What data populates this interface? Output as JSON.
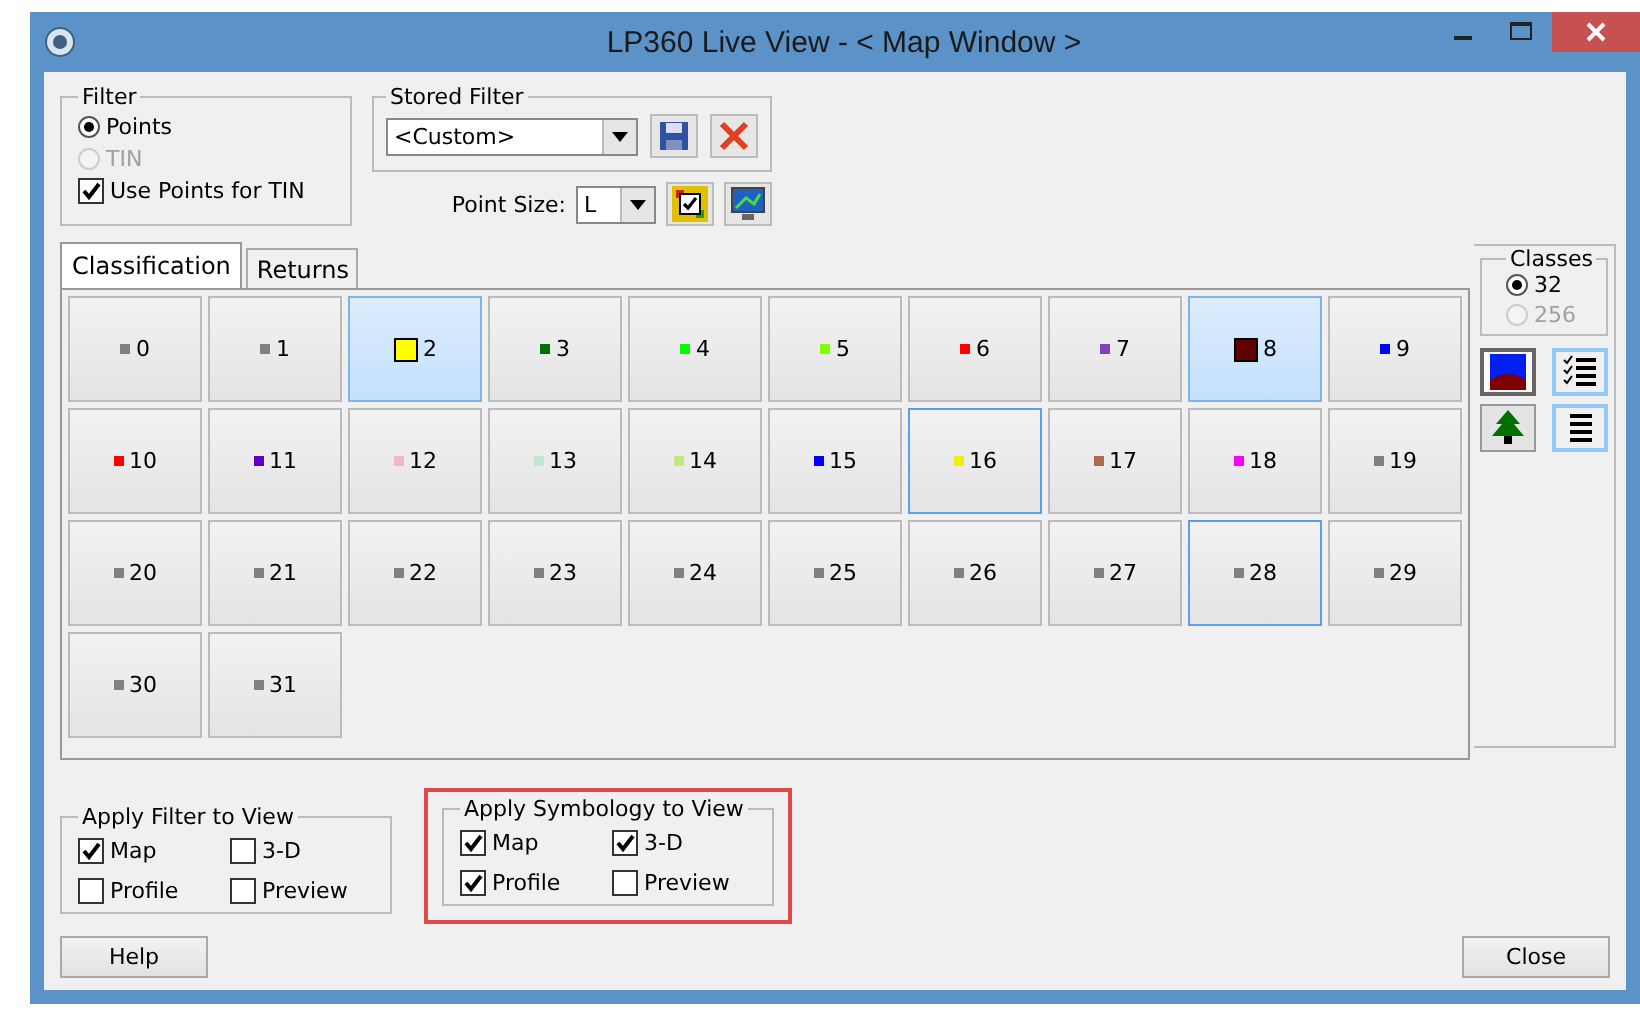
{
  "window": {
    "title": "LP360 Live View - < Map Window >"
  },
  "filter": {
    "title": "Filter",
    "options": [
      {
        "label": "Points",
        "selected": true,
        "disabled": false
      },
      {
        "label": "TIN",
        "selected": false,
        "disabled": true
      }
    ],
    "use_points_for_tin": {
      "label": "Use Points for TIN",
      "checked": true
    }
  },
  "stored_filter": {
    "title": "Stored Filter",
    "value": "<Custom>"
  },
  "point_size": {
    "label": "Point Size:",
    "value": "L"
  },
  "tabs": [
    {
      "label": "Classification",
      "selected": true
    },
    {
      "label": "Returns",
      "selected": false
    }
  ],
  "classes": [
    {
      "label": "0",
      "color": "#808080",
      "selected": false,
      "outlined": false
    },
    {
      "label": "1",
      "color": "#808080",
      "selected": false,
      "outlined": false
    },
    {
      "label": "2",
      "color": "#ffff00",
      "selected": true,
      "outlined": false
    },
    {
      "label": "3",
      "color": "#007000",
      "selected": false,
      "outlined": false
    },
    {
      "label": "4",
      "color": "#00ff00",
      "selected": false,
      "outlined": false
    },
    {
      "label": "5",
      "color": "#80ff00",
      "selected": false,
      "outlined": false
    },
    {
      "label": "6",
      "color": "#ff0000",
      "selected": false,
      "outlined": false
    },
    {
      "label": "7",
      "color": "#8040c0",
      "selected": false,
      "outlined": false
    },
    {
      "label": "8",
      "color": "#600000",
      "selected": true,
      "outlined": false
    },
    {
      "label": "9",
      "color": "#0000ff",
      "selected": false,
      "outlined": false
    },
    {
      "label": "10",
      "color": "#ff0000",
      "selected": false,
      "outlined": false
    },
    {
      "label": "11",
      "color": "#6000c0",
      "selected": false,
      "outlined": false
    },
    {
      "label": "12",
      "color": "#f0b8c8",
      "selected": false,
      "outlined": false
    },
    {
      "label": "13",
      "color": "#c0e8d0",
      "selected": false,
      "outlined": false
    },
    {
      "label": "14",
      "color": "#c0e880",
      "selected": false,
      "outlined": false
    },
    {
      "label": "15",
      "color": "#0000ff",
      "selected": false,
      "outlined": false
    },
    {
      "label": "16",
      "color": "#f0f000",
      "selected": false,
      "outlined": true
    },
    {
      "label": "17",
      "color": "#b06850",
      "selected": false,
      "outlined": false
    },
    {
      "label": "18",
      "color": "#ff00ff",
      "selected": false,
      "outlined": false
    },
    {
      "label": "19",
      "color": "#808080",
      "selected": false,
      "outlined": false
    },
    {
      "label": "20",
      "color": "#808080",
      "selected": false,
      "outlined": false
    },
    {
      "label": "21",
      "color": "#808080",
      "selected": false,
      "outlined": false
    },
    {
      "label": "22",
      "color": "#808080",
      "selected": false,
      "outlined": false
    },
    {
      "label": "23",
      "color": "#808080",
      "selected": false,
      "outlined": false
    },
    {
      "label": "24",
      "color": "#808080",
      "selected": false,
      "outlined": false
    },
    {
      "label": "25",
      "color": "#808080",
      "selected": false,
      "outlined": false
    },
    {
      "label": "26",
      "color": "#808080",
      "selected": false,
      "outlined": false
    },
    {
      "label": "27",
      "color": "#808080",
      "selected": false,
      "outlined": false
    },
    {
      "label": "28",
      "color": "#808080",
      "selected": false,
      "outlined": true
    },
    {
      "label": "29",
      "color": "#808080",
      "selected": false,
      "outlined": false
    },
    {
      "label": "30",
      "color": "#808080",
      "selected": false,
      "outlined": false
    },
    {
      "label": "31",
      "color": "#808080",
      "selected": false,
      "outlined": false
    }
  ],
  "classes_group": {
    "title": "Classes",
    "options": [
      {
        "label": "32",
        "selected": true,
        "disabled": false
      },
      {
        "label": "256",
        "selected": false,
        "disabled": true
      }
    ]
  },
  "apply_filter": {
    "title": "Apply Filter to View",
    "highlighted": false,
    "options": [
      {
        "label": "Map",
        "checked": true
      },
      {
        "label": "3-D",
        "checked": false
      },
      {
        "label": "Profile",
        "checked": false
      },
      {
        "label": "Preview",
        "checked": false
      }
    ]
  },
  "apply_symbology": {
    "title": "Apply Symbology to View",
    "highlighted": true,
    "options": [
      {
        "label": "Map",
        "checked": true
      },
      {
        "label": "3-D",
        "checked": true
      },
      {
        "label": "Profile",
        "checked": true
      },
      {
        "label": "Preview",
        "checked": false
      }
    ]
  },
  "buttons": [
    {
      "label": "Help"
    },
    {
      "label": "Close"
    }
  ]
}
